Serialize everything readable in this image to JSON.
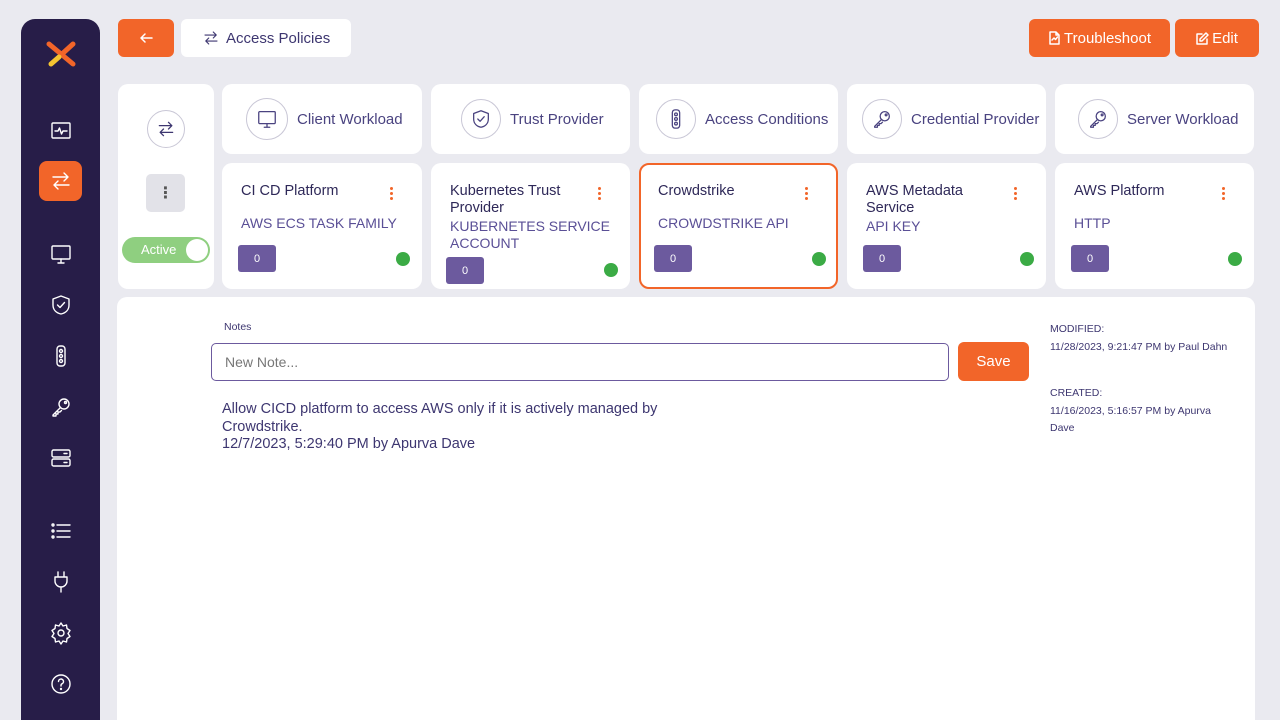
{
  "sidebar": {
    "items": [
      {
        "icon": "activity-monitor-icon"
      },
      {
        "icon": "access-policies-icon",
        "active": true
      },
      {
        "icon": "client-workload-icon"
      },
      {
        "icon": "trust-provider-icon"
      },
      {
        "icon": "access-conditions-icon"
      },
      {
        "icon": "credential-provider-icon"
      },
      {
        "icon": "server-workload-icon"
      },
      {
        "icon": "list-icon"
      },
      {
        "icon": "plug-icon"
      },
      {
        "icon": "settings-icon"
      },
      {
        "icon": "help-icon"
      }
    ]
  },
  "topbar": {
    "breadcrumb": "Access Policies",
    "troubleshoot_label": "Troubleshoot",
    "edit_label": "Edit"
  },
  "policy": {
    "status_label": "Active"
  },
  "columns": [
    {
      "header": "Client Workload",
      "icon": "monitor-icon",
      "item": {
        "title": "CI CD Platform",
        "subtitle": "AWS ECS TASK FAMILY",
        "count": "0",
        "status": "green"
      }
    },
    {
      "header": "Trust Provider",
      "icon": "shield-check-icon",
      "item": {
        "title": "Kubernetes Trust Provider",
        "subtitle": "KUBERNETES SERVICE ACCOUNT",
        "count": "0",
        "status": "green"
      }
    },
    {
      "header": "Access Conditions",
      "icon": "traffic-light-icon",
      "item": {
        "title": "Crowdstrike",
        "subtitle": "CROWDSTRIKE API",
        "count": "0",
        "status": "green",
        "selected": true
      }
    },
    {
      "header": "Credential Provider",
      "icon": "key-icon",
      "item": {
        "title": "AWS Metadata Service",
        "subtitle": "API KEY",
        "count": "0",
        "status": "green"
      }
    },
    {
      "header": "Server Workload",
      "icon": "key-icon",
      "item": {
        "title": "AWS Platform",
        "subtitle": "HTTP",
        "count": "0",
        "status": "green"
      }
    }
  ],
  "notes": {
    "label": "Notes",
    "placeholder": "New Note...",
    "save_label": "Save",
    "entries": [
      {
        "text": "Allow CICD platform to access AWS only if it is actively managed by Crowdstrike.",
        "meta": "12/7/2023, 5:29:40 PM by Apurva Dave"
      }
    ]
  },
  "meta": {
    "modified_label": "MODIFIED:",
    "modified_value": "11/28/2023, 9:21:47 PM by Paul Dahn",
    "created_label": "CREATED:",
    "created_value": "11/16/2023, 5:16:57 PM by Apurva Dave"
  },
  "colors": {
    "accent": "#f26529",
    "sidebar": "#271d48",
    "badge": "#6c5a9e",
    "status_green": "#3bab45",
    "toggle_green": "#8fcf80"
  }
}
